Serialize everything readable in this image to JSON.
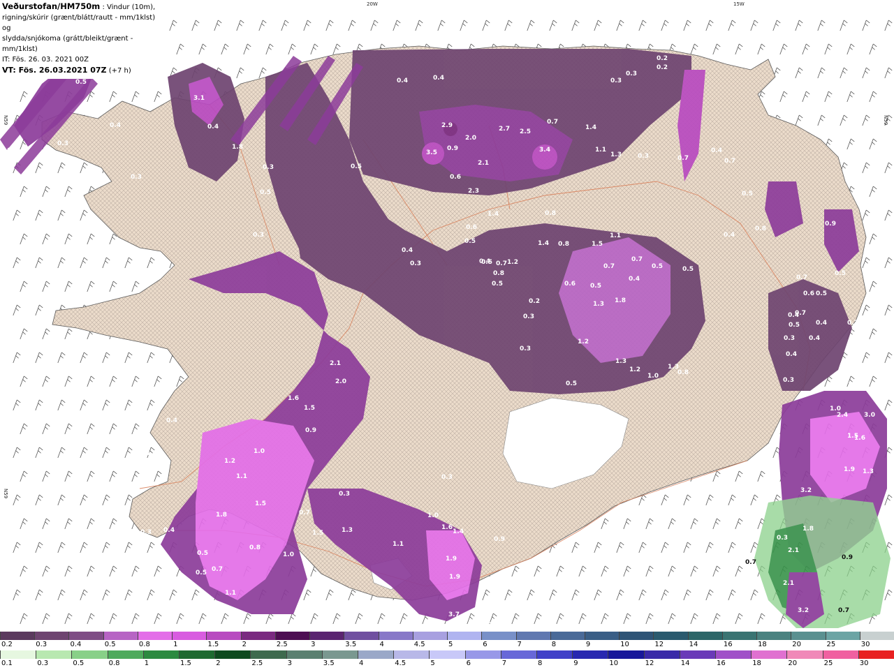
{
  "header": {
    "title_bold": "Veðurstofan/HM750m",
    "title_rest": " : Vindur (10m),",
    "line2": "rigning/skúrir (grænt/blátt/rautt - mm/1klst) og",
    "line3": "slydda/snjókoma (grátt/bleikt/grænt - mm/1klst)",
    "it": "IT: Fös. 26. 03. 2021 00Z",
    "vt": "VT: Fös. 26.03.2021 07Z",
    "vt_offset": " (+7 h)"
  },
  "longitude_labels": [
    "20W",
    "15W"
  ],
  "latitude_labels": [
    "N59",
    "N59",
    "N59"
  ],
  "colors": {
    "sea": "#ffffff",
    "land": "#ecdccb",
    "roads": "#d9805a",
    "snow_light": "#6e4470",
    "snow_mid": "#8c3c9a",
    "snow_heavy": "#e36ee8",
    "rain_green": "#3f9b57"
  },
  "snow_scale": {
    "labels": [
      "0.2",
      "0.3",
      "0.4",
      "0.5",
      "0.8",
      "1",
      "1.5",
      "2",
      "2.5",
      "3",
      "3.5",
      "4",
      "4.5",
      "5",
      "6",
      "7",
      "8",
      "9",
      "10",
      "12",
      "14",
      "16",
      "18",
      "20",
      "25",
      "30"
    ],
    "colors": [
      "#5b3a5e",
      "#6e4470",
      "#7f4d85",
      "#b764c4",
      "#e36ee8",
      "#d85ce0",
      "#b84ac0",
      "#7a2a80",
      "#4d0e52",
      "#5a2470",
      "#7050a0",
      "#8878c8",
      "#a8a0e0",
      "#b0b4f0",
      "#7890c8",
      "#6078b0",
      "#4a6a98",
      "#3a5e86",
      "#2e5476",
      "#2a5a6e",
      "#2c6668",
      "#3a7472",
      "#4a8280",
      "#5a9090",
      "#6ca4a4",
      "#c8d0d0"
    ]
  },
  "rain_scale": {
    "labels": [
      "0.1",
      "0.3",
      "0.5",
      "0.8",
      "1",
      "1.5",
      "2",
      "2.5",
      "3",
      "3.5",
      "4",
      "4.5",
      "5",
      "6",
      "7",
      "8",
      "9",
      "10",
      "12",
      "14",
      "16",
      "18",
      "20",
      "25",
      "30"
    ],
    "colors": [
      "#e6f7e0",
      "#b8e8b0",
      "#88d088",
      "#4eaa5c",
      "#2c8a40",
      "#1e6a30",
      "#0e4a1e",
      "#3e6a4e",
      "#5a8070",
      "#7a9890",
      "#9aa8c8",
      "#b8b8e8",
      "#c8c8f8",
      "#9898e8",
      "#6868d8",
      "#4040c8",
      "#2828b0",
      "#18189a",
      "#3a2aa8",
      "#6a3ab8",
      "#a050c8",
      "#e070d0",
      "#f088b8",
      "#f060a0",
      "#e82020"
    ]
  },
  "map_values": [
    {
      "v": "2.3"
    },
    {
      "v": "1.2"
    },
    {
      "v": "0.5"
    },
    {
      "v": "0.3"
    },
    {
      "v": "3.1"
    },
    {
      "v": "0.4"
    },
    {
      "v": "1.8"
    },
    {
      "v": "0.3"
    },
    {
      "v": "0.4"
    },
    {
      "v": "0.3"
    },
    {
      "v": "0.3"
    },
    {
      "v": "0.5"
    },
    {
      "v": "0.3"
    },
    {
      "v": "0.4"
    },
    {
      "v": "0.4"
    },
    {
      "v": "0.2"
    },
    {
      "v": "0.2"
    },
    {
      "v": "0.3"
    },
    {
      "v": "0.3"
    },
    {
      "v": "2.9"
    },
    {
      "v": "2.0"
    },
    {
      "v": "3.5"
    },
    {
      "v": "0.9"
    },
    {
      "v": "2.7"
    },
    {
      "v": "2.5"
    },
    {
      "v": "3.4"
    },
    {
      "v": "0.7"
    },
    {
      "v": "1.4"
    },
    {
      "v": "1.1"
    },
    {
      "v": "1.3"
    },
    {
      "v": "0.3"
    },
    {
      "v": "0.4"
    },
    {
      "v": "0.7"
    },
    {
      "v": "0.7"
    },
    {
      "v": "2.1"
    },
    {
      "v": "2.3"
    },
    {
      "v": "0.6"
    },
    {
      "v": "0.5"
    },
    {
      "v": "0.8"
    },
    {
      "v": "1.4"
    },
    {
      "v": "1.4"
    },
    {
      "v": "0.8"
    },
    {
      "v": "1.5"
    },
    {
      "v": "1.1"
    },
    {
      "v": "0.3"
    },
    {
      "v": "0.3"
    },
    {
      "v": "0.4"
    },
    {
      "v": "0.5"
    },
    {
      "v": "0.6"
    },
    {
      "v": "0.5"
    },
    {
      "v": "0.8"
    },
    {
      "v": "0.7"
    },
    {
      "v": "0.4"
    },
    {
      "v": "1.2"
    },
    {
      "v": "0.5"
    },
    {
      "v": "0.6"
    },
    {
      "v": "0.5"
    },
    {
      "v": "0.4"
    },
    {
      "v": "0.5"
    },
    {
      "v": "0.7"
    },
    {
      "v": "0.7"
    },
    {
      "v": "0.5"
    },
    {
      "v": "0.2"
    },
    {
      "v": "0.3"
    },
    {
      "v": "1.3"
    },
    {
      "v": "1.8"
    },
    {
      "v": "1.3"
    },
    {
      "v": "0.3"
    },
    {
      "v": "1.2"
    },
    {
      "v": "1.3"
    },
    {
      "v": "1.2"
    },
    {
      "v": "1.0"
    },
    {
      "v": "0.8"
    },
    {
      "v": "0.5"
    },
    {
      "v": "2.0"
    },
    {
      "v": "2.1"
    },
    {
      "v": "1.6"
    },
    {
      "v": "1.5"
    },
    {
      "v": "0.9"
    },
    {
      "v": "0.4"
    },
    {
      "v": "0.4"
    },
    {
      "v": "1.2"
    },
    {
      "v": "1.0"
    },
    {
      "v": "1.1"
    },
    {
      "v": "1.5"
    },
    {
      "v": "1.8"
    },
    {
      "v": "0.8"
    },
    {
      "v": "1.0"
    },
    {
      "v": "0.7"
    },
    {
      "v": "0.3"
    },
    {
      "v": "1.3"
    },
    {
      "v": "1.5"
    },
    {
      "v": "1.0"
    },
    {
      "v": "1.6"
    },
    {
      "v": "1.4"
    },
    {
      "v": "0.3"
    },
    {
      "v": "0.9"
    },
    {
      "v": "0.3"
    },
    {
      "v": "0.4"
    },
    {
      "v": "0.5"
    },
    {
      "v": "0.5"
    },
    {
      "v": "0.7"
    },
    {
      "v": "1.1"
    },
    {
      "v": "1.1"
    },
    {
      "v": "1.9"
    },
    {
      "v": "1.9"
    },
    {
      "v": "3.7"
    },
    {
      "v": "3.5"
    },
    {
      "v": "2.4"
    },
    {
      "v": "3.0"
    },
    {
      "v": "1.5"
    },
    {
      "v": "1.6"
    },
    {
      "v": "1.9"
    },
    {
      "v": "1.3"
    },
    {
      "v": "3.2"
    },
    {
      "v": "1.8"
    },
    {
      "v": "0.3"
    },
    {
      "v": "2.1"
    },
    {
      "v": "0.7"
    },
    {
      "v": "0.9"
    },
    {
      "v": "2.1"
    },
    {
      "v": "3.2"
    },
    {
      "v": "0.7"
    },
    {
      "v": "0.4"
    },
    {
      "v": "0.4"
    },
    {
      "v": "0.5"
    },
    {
      "v": "0.3"
    },
    {
      "v": "0.4"
    },
    {
      "v": "0.6"
    },
    {
      "v": "0.5"
    },
    {
      "v": "0.3"
    },
    {
      "v": "1.0"
    },
    {
      "v": "1.0"
    },
    {
      "v": "0.4"
    },
    {
      "v": "0.5"
    },
    {
      "v": "0.7"
    },
    {
      "v": "0.3"
    },
    {
      "v": "0.7"
    },
    {
      "v": "0.4"
    },
    {
      "v": "0.9"
    },
    {
      "v": "0.5"
    },
    {
      "v": "0.8"
    }
  ]
}
